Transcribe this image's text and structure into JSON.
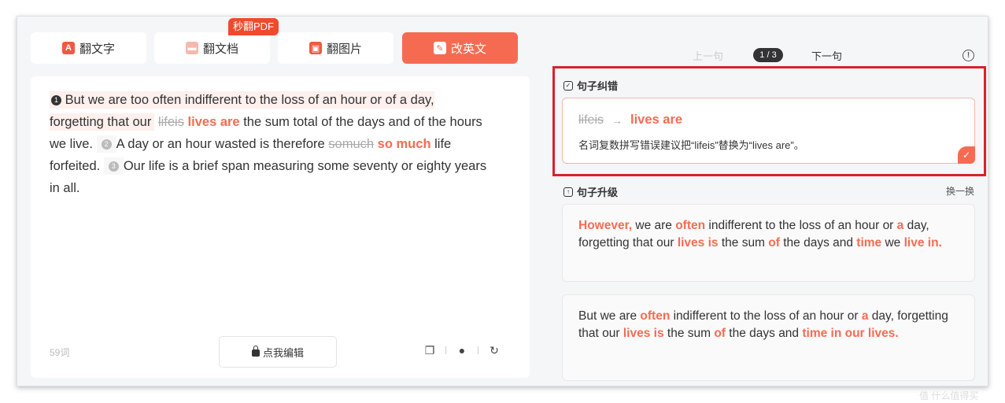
{
  "tabs": [
    {
      "label": "翻文字",
      "icon": "A",
      "active": false
    },
    {
      "label": "翻文档",
      "icon": "doc",
      "active": false
    },
    {
      "label": "翻图片",
      "icon": "img",
      "active": false
    },
    {
      "label": "改英文",
      "icon": "edit",
      "active": true
    }
  ],
  "badge": "秒翻PDF",
  "passage": {
    "s1_num": "1",
    "s1_a": "But we are too often indifferent to the loss of an hour or of a day, forgetting that our",
    "s1_strike": "lifeis",
    "s1_fix": "lives are",
    "s1_b": "the sum total of the days and of the hours we live.",
    "s2_num": "2",
    "s2_a": "A day or an hour wasted is therefore",
    "s2_strike": "somuch",
    "s2_fix": "so much",
    "s2_b": "life forfeited.",
    "s3_num": "3",
    "s3_a": "Our life is a brief span measuring some seventy or eighty years in all."
  },
  "word_count": "59词",
  "edit_button": "点我编辑",
  "nav": {
    "prev": "上一句",
    "page": "1 / 3",
    "next": "下一句",
    "info": "!"
  },
  "correction": {
    "title": "句子纠错",
    "from": "lifeis",
    "arrow": "→",
    "to": "lives are",
    "desc": "名词复数拼写错误建议把“lifeis”替换为“lives are”。",
    "check": "✓"
  },
  "upgrade": {
    "title": "句子升级",
    "swap": "换一换",
    "card1": {
      "p1": "However,",
      "t1": " we are ",
      "p2": "often",
      "t2": " indifferent to the loss of an hour or ",
      "p3": "a",
      "t3": " day, forgetting that our ",
      "p4": "lives is",
      "t4": " the sum ",
      "p5": "of",
      "t5": " the days and ",
      "p6": "time",
      "t6": " we ",
      "p7": "live in."
    },
    "card2": {
      "t0": "But we are ",
      "p1": "often",
      "t1": " indifferent to the loss of an hour or ",
      "p2": "a",
      "t2": " day, forgetting that our ",
      "p3": "lives is",
      "t3": " the sum ",
      "p4": "of",
      "t4": " the days and ",
      "p5": "time in our lives."
    }
  },
  "watermark": "值 什么值得买"
}
